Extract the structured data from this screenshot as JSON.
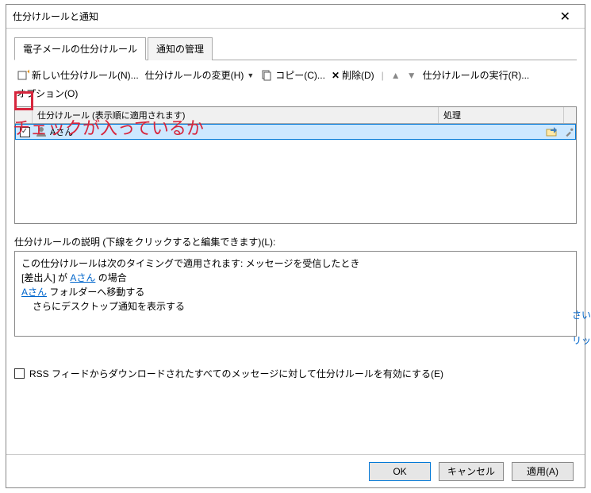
{
  "dialog": {
    "title": "仕分けルールと通知"
  },
  "tabs": {
    "items": [
      {
        "label": "電子メールの仕分けルール",
        "active": true
      },
      {
        "label": "通知の管理",
        "active": false
      }
    ]
  },
  "toolbar": {
    "new_rule": "新しい仕分けルール(N)...",
    "change_rule": "仕分けルールの変更(H)",
    "copy": "コピー(C)...",
    "delete": "削除(D)",
    "run_rules": "仕分けルールの実行(R)...",
    "options": "オプション(O)"
  },
  "rule_list": {
    "header_name": "仕分けルール (表示順に適用されます)",
    "header_action": "処理",
    "rows": [
      {
        "checked": true,
        "name": "Aさん"
      }
    ]
  },
  "description": {
    "label": "仕分けルールの説明 (下線をクリックすると編集できます)(L):",
    "line1": "この仕分けルールは次のタイミングで適用されます: メッセージを受信したとき",
    "line2_prefix": "[差出人] が ",
    "line2_link": "Aさん",
    "line2_suffix": " の場合",
    "line3_link": "Aさん",
    "line3_suffix": " フォルダーへ移動する",
    "line4": "さらにデスクトップ通知を表示する"
  },
  "rss_checkbox": {
    "label": "RSS フィードからダウンロードされたすべてのメッセージに対して仕分けルールを有効にする(E)"
  },
  "buttons": {
    "ok": "OK",
    "cancel": "キャンセル",
    "apply": "適用(A)"
  },
  "annotation": {
    "text": "チェックが入っているか"
  },
  "side_text": {
    "line1": "さい",
    "line2": "リッ"
  }
}
